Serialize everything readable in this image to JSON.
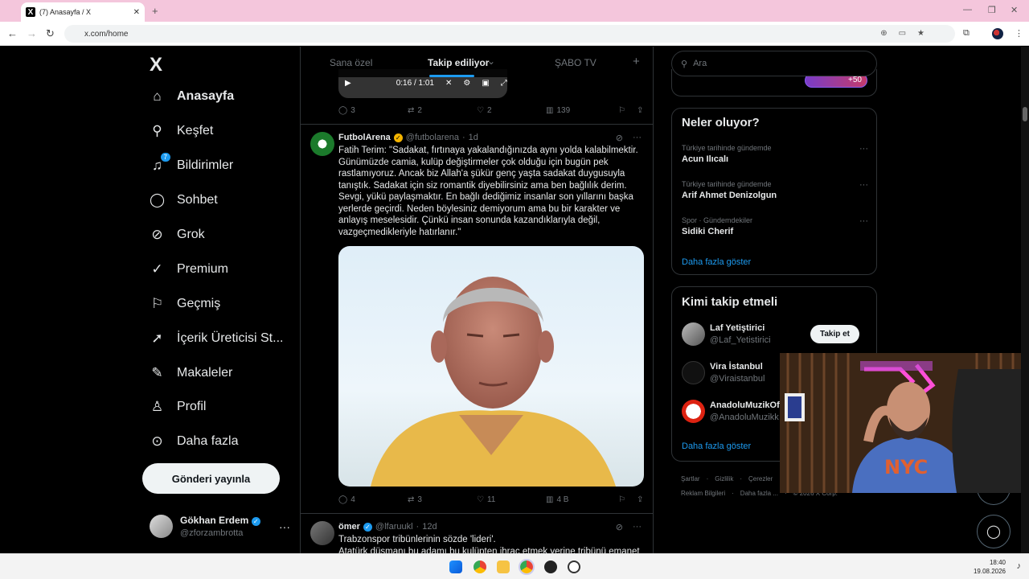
{
  "browser": {
    "tab_title": "(7) Anasayfa / X",
    "url": "x.com/home"
  },
  "nav": {
    "brand": "X",
    "items": [
      {
        "label": "Anasayfa",
        "icon": "home-icon"
      },
      {
        "label": "Keşfet",
        "icon": "search-icon"
      },
      {
        "label": "Bildirimler",
        "icon": "bell-icon",
        "badge": "7"
      },
      {
        "label": "Sohbet",
        "icon": "chat-icon"
      },
      {
        "label": "Grok",
        "icon": "grok-icon"
      },
      {
        "label": "Premium",
        "icon": "premium-icon"
      },
      {
        "label": "Geçmiş",
        "icon": "bookmark-icon"
      },
      {
        "label": "İçerik Üreticisi St...",
        "icon": "rocket-icon"
      },
      {
        "label": "Makaleler",
        "icon": "article-icon"
      },
      {
        "label": "Profil",
        "icon": "person-icon"
      },
      {
        "label": "Daha fazla",
        "icon": "more-circle-icon"
      }
    ],
    "post_button": "Gönderi yayınla",
    "me": {
      "name": "Gökhan Erdem",
      "handle": "@zforzambrotta"
    }
  },
  "feed": {
    "tabs": [
      "Sana özel",
      "Takip ediliyor",
      "ŞABO TV"
    ],
    "selected_tab": "Takip ediliyor",
    "video_time": "0:16 / 1:01",
    "prev_actions": {
      "replies": "3",
      "reposts": "2",
      "likes": "2",
      "views": "139"
    },
    "tweet1": {
      "name": "FutbolArena",
      "handle": "@futbolarena",
      "time": "1d",
      "text": "Fatih Terim: \"Sadakat, fırtınaya yakalandığınızda aynı yolda kalabilmektir. Günümüzde camia, kulüp değiştirmeler çok olduğu için bugün pek rastlamıyoruz. Ancak biz Allah'a şükür genç yaşta sadakat duygusuyla tanıştık. Sadakat için siz romantik diyebilirsiniz ama ben bağlılık derim. Sevgi, yükü paylaşmaktır. En bağlı dediğimiz insanlar son yıllarını başka yerlerde geçirdi. Neden böylesiniz demiyorum ama bu bir karakter ve anlayış meselesidir. Çünkü insan sonunda kazandıklarıyla değil, vazgeçmedikleriyle hatırlanır.\"",
      "actions": {
        "replies": "4",
        "reposts": "3",
        "likes": "11",
        "views": "4 B"
      }
    },
    "tweet2": {
      "name": "ömer",
      "handle": "@lfaruukl",
      "time": "12d",
      "text": "Trabzonspor tribünlerinin sözde 'lideri'.",
      "text2": "Atatürk düşmanı bu adamı bu kulüpten ihraç etmek yerine tribünü emanet"
    }
  },
  "right": {
    "search_placeholder": "Ara",
    "top_badge": "+50",
    "trends_title": "Neler oluyor?",
    "trends": [
      {
        "context": "Türkiye tarihinde gündemde",
        "title": "Acun Ilıcalı"
      },
      {
        "context": "Türkiye tarihinde gündemde",
        "title": "Arif Ahmet Denizolgun"
      },
      {
        "context": "Spor · Gündemdekiler",
        "title": "Sidiki Cherif"
      }
    ],
    "show_more": "Daha fazla göster",
    "who_title": "Kimi takip etmeli",
    "who": [
      {
        "name": "Laf Yetiştirici",
        "handle": "@Laf_Yetistirici"
      },
      {
        "name": "Vira İstanbul",
        "handle": "@Viraistanbul"
      },
      {
        "name": "AnadoluMuzikOf",
        "handle": "@AnadoluMuzikk"
      }
    ],
    "follow_label": "Takip et",
    "footer_row1": [
      "Şartlar",
      "Gizlilik",
      "Çerezler"
    ],
    "footer_row2": [
      "Reklam Bilgileri",
      "Daha fazla ...",
      "© 2026 X Corp."
    ]
  },
  "taskbar": {
    "time": "18:40",
    "date": "19.08.2026"
  }
}
